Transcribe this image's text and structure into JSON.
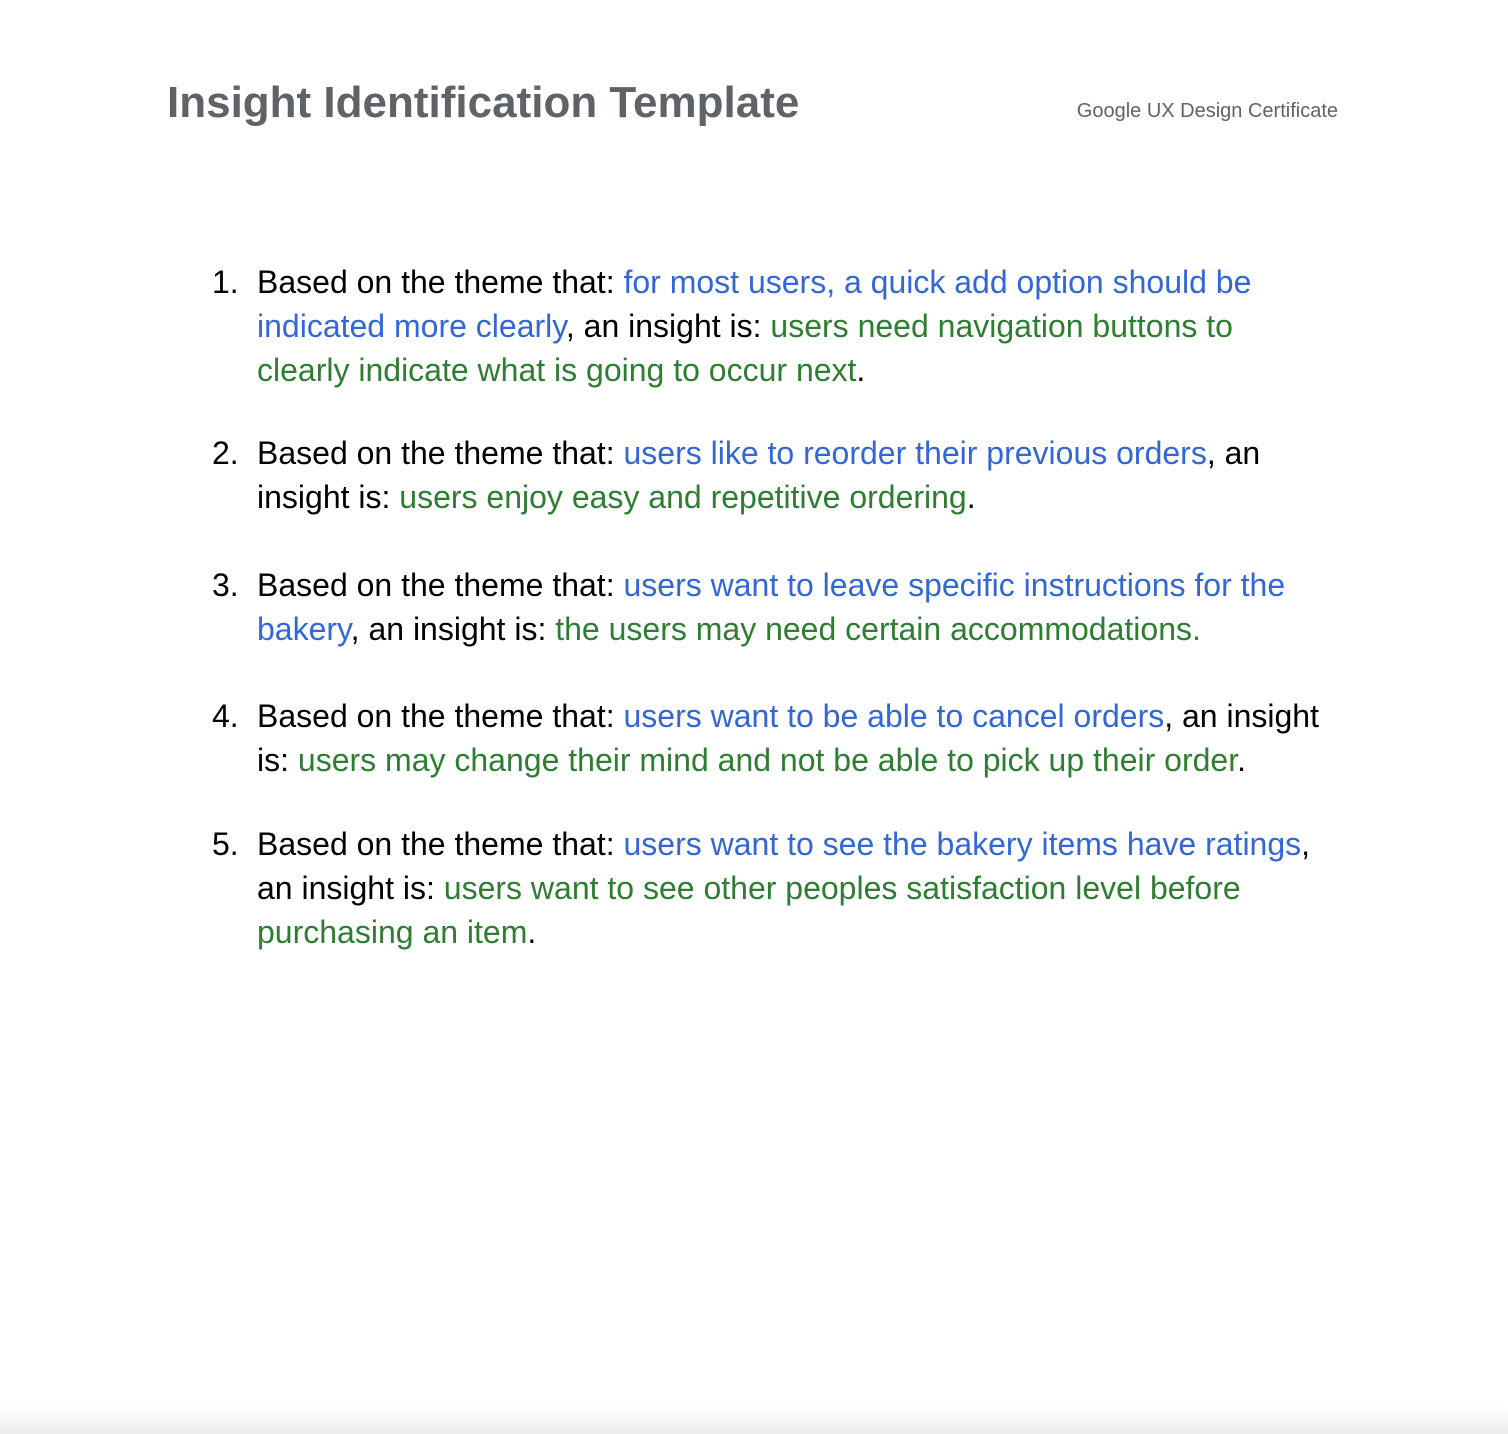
{
  "header": {
    "title": "Insight Identification Template",
    "subtitle": "Google UX Design Certificate"
  },
  "colors": {
    "title": "#5f6368",
    "theme_text": "#3367d6",
    "insight_text": "#2e7d32",
    "body_text": "#000000"
  },
  "items": [
    {
      "number": "1.",
      "prefix": "Based on the theme that: ",
      "theme": "for most users, a quick add option should be indicated more clearly",
      "middle": ", an insight is: ",
      "insight": "users need navigation buttons to clearly indicate what is going to occur next",
      "suffix": "."
    },
    {
      "number": "2.",
      "prefix": "Based on the theme that: ",
      "theme": "users like to reorder their previous orders",
      "middle": ", an insight is: ",
      "insight": "users enjoy easy and repetitive ordering",
      "suffix": "."
    },
    {
      "number": "3.",
      "prefix": "Based on the theme that: ",
      "theme": "users want to leave specific instructions for the bakery",
      "middle": ", an insight is: ",
      "insight": "the users may need certain accommodations.",
      "suffix": ""
    },
    {
      "number": "4.",
      "prefix": "Based on the theme that: ",
      "theme": "users want to be able to cancel orders",
      "middle": ", an insight is: ",
      "insight": "users may change their mind and not be able to pick up their order",
      "suffix": "."
    },
    {
      "number": "5.",
      "prefix": "Based on the theme that: ",
      "theme": "users want to see the bakery items have ratings",
      "middle": ", an insight is: ",
      "insight": "users want to see other peoples satisfaction level before purchasing an item",
      "suffix": "."
    }
  ]
}
